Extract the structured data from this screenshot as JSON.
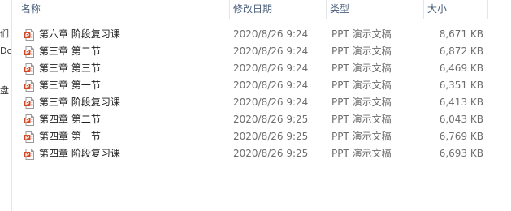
{
  "columns": {
    "name": "名称",
    "date": "修改日期",
    "type": "类型",
    "size": "大小"
  },
  "nav_stubs": [
    "们",
    "Dc",
    "盘"
  ],
  "files": [
    {
      "name": "第六章  阶段复习课",
      "date": "2020/8/26 9:24",
      "type": "PPT 演示文稿",
      "size": "8,671 KB",
      "icon": "powerpoint-file-icon"
    },
    {
      "name": "第三章  第二节",
      "date": "2020/8/26 9:24",
      "type": "PPT 演示文稿",
      "size": "6,872 KB",
      "icon": "powerpoint-file-icon"
    },
    {
      "name": "第三章  第三节",
      "date": "2020/8/26 9:24",
      "type": "PPT 演示文稿",
      "size": "6,469 KB",
      "icon": "powerpoint-file-icon"
    },
    {
      "name": "第三章  第一节",
      "date": "2020/8/26 9:24",
      "type": "PPT 演示文稿",
      "size": "6,351 KB",
      "icon": "powerpoint-file-icon"
    },
    {
      "name": "第三章  阶段复习课",
      "date": "2020/8/26 9:24",
      "type": "PPT 演示文稿",
      "size": "6,413 KB",
      "icon": "powerpoint-file-icon"
    },
    {
      "name": "第四章  第二节",
      "date": "2020/8/26 9:25",
      "type": "PPT 演示文稿",
      "size": "6,043 KB",
      "icon": "powerpoint-file-icon"
    },
    {
      "name": "第四章  第一节",
      "date": "2020/8/26 9:25",
      "type": "PPT 演示文稿",
      "size": "6,769 KB",
      "icon": "powerpoint-file-icon"
    },
    {
      "name": "第四章  阶段复习课",
      "date": "2020/8/26 9:25",
      "type": "PPT 演示文稿",
      "size": "6,693 KB",
      "icon": "powerpoint-file-icon"
    }
  ],
  "colors": {
    "header_text": "#4c607a",
    "icon_accent": "#d24625"
  }
}
